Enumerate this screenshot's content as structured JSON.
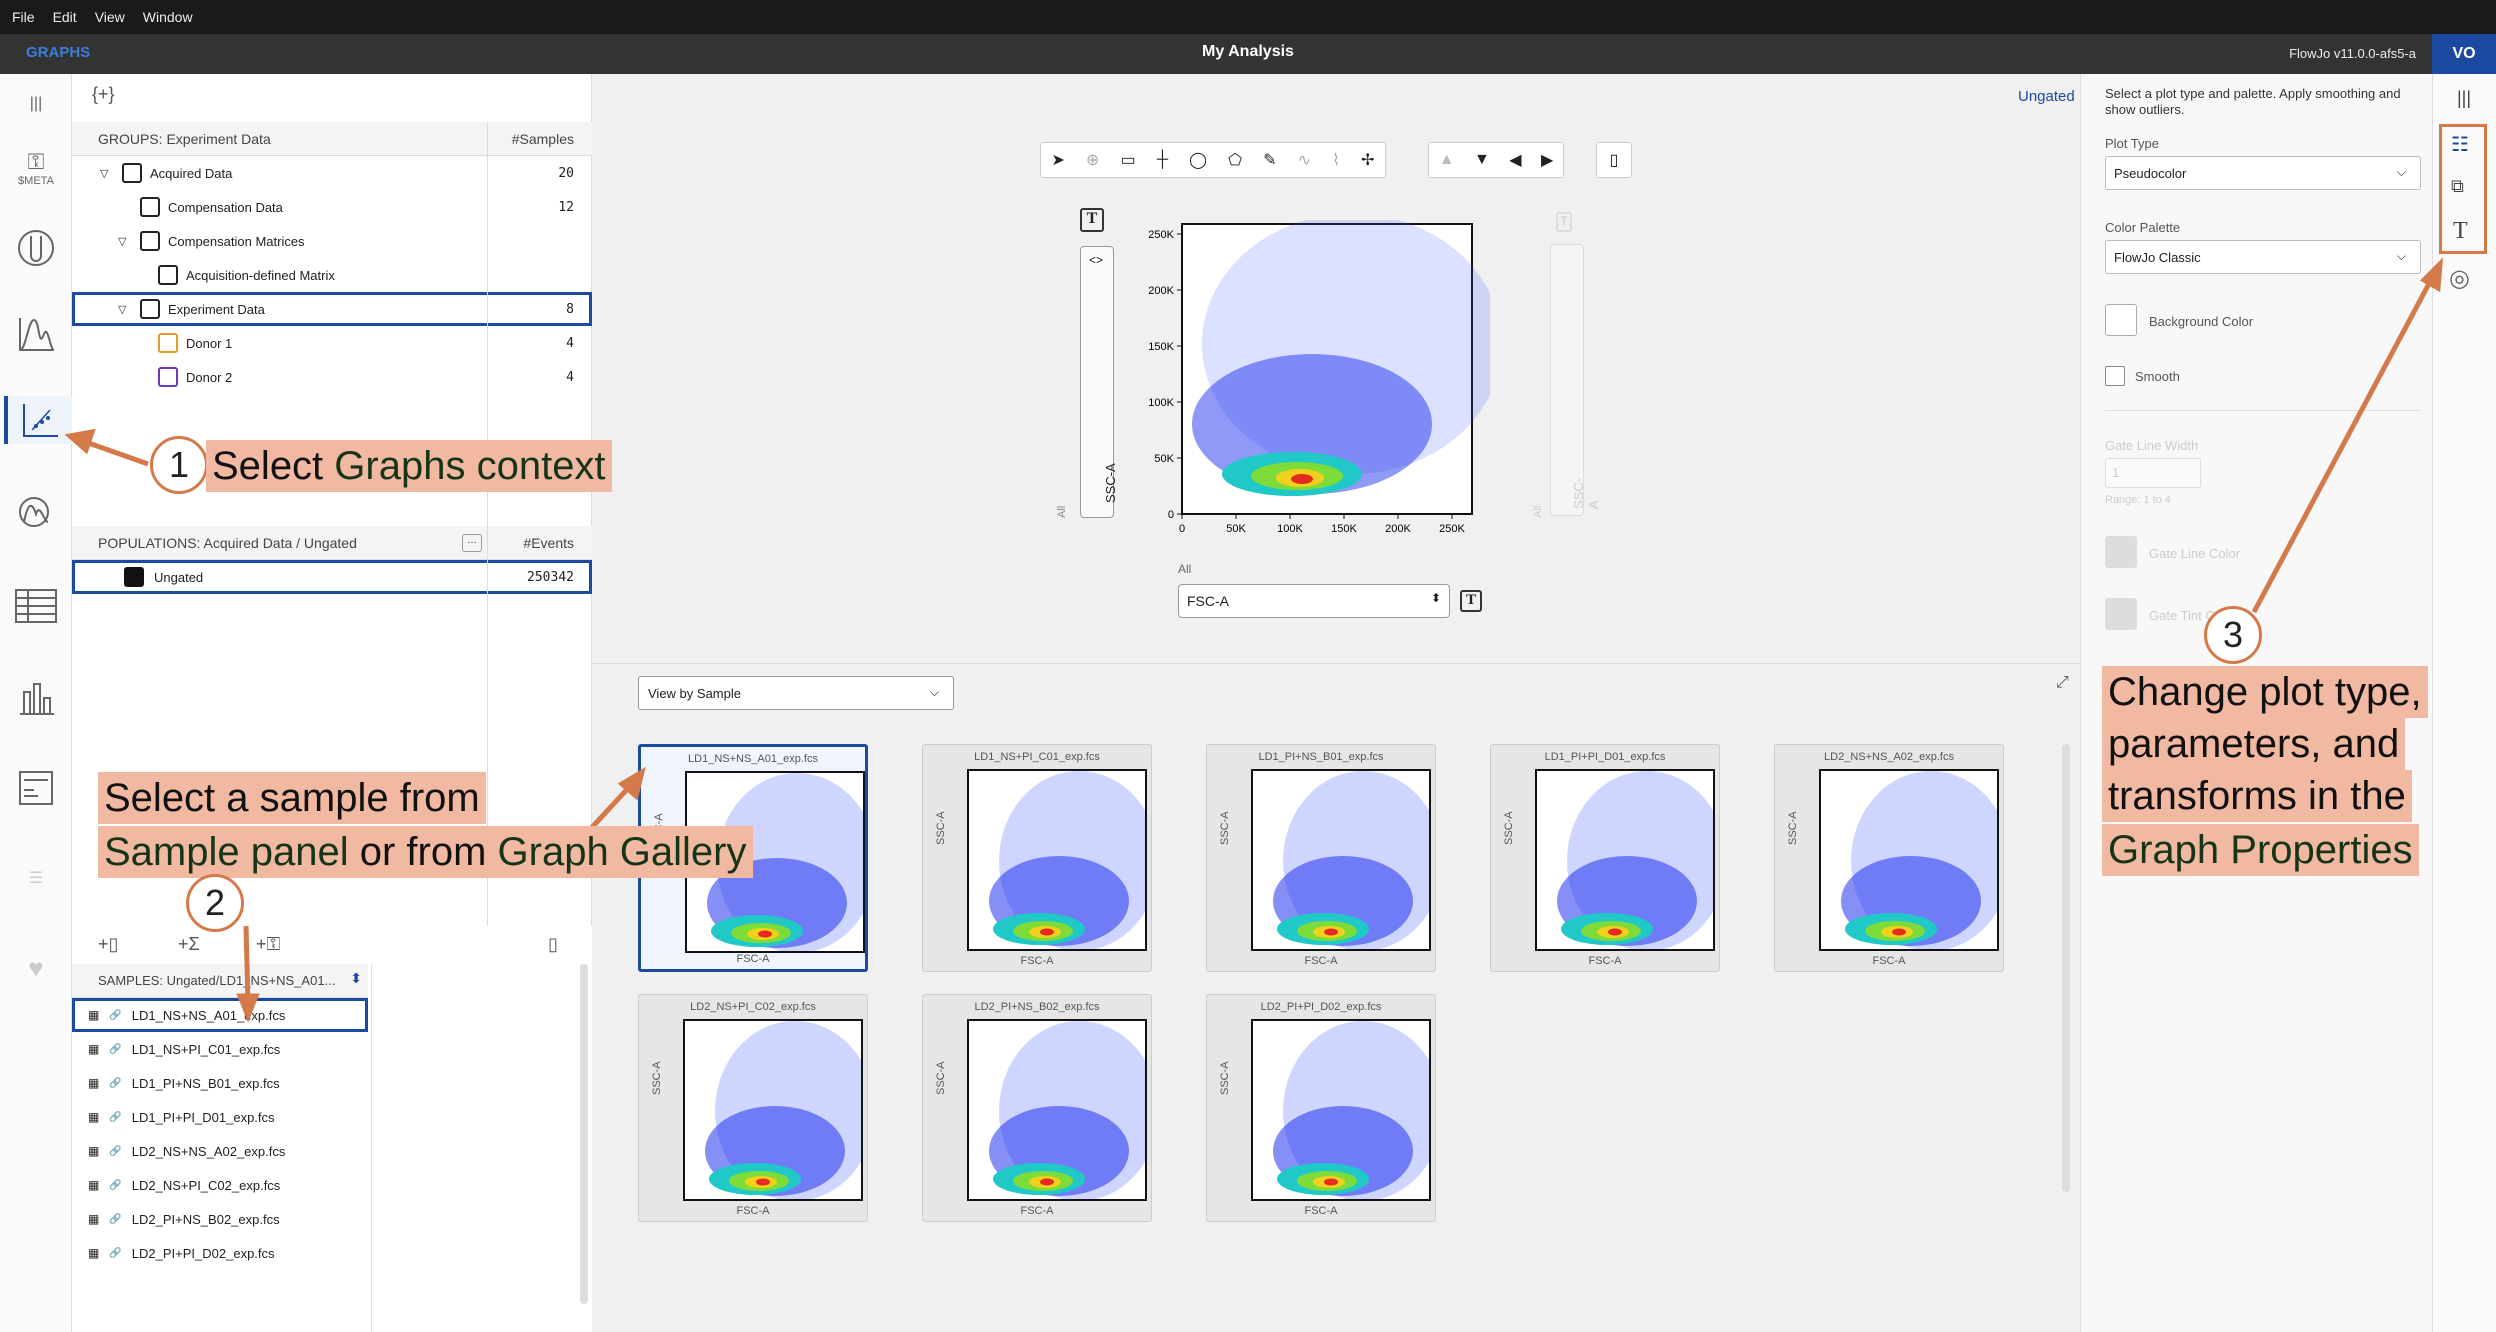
{
  "menu": [
    "File",
    "Edit",
    "View",
    "Window"
  ],
  "titlebar": {
    "context": "GRAPHS",
    "title": "My Analysis",
    "version": "FlowJo v11.0.0-afs5-a",
    "avatar": "VO"
  },
  "rail": {
    "meta_label": "$META"
  },
  "groups": {
    "header": "GROUPS: Experiment Data",
    "count_header": "#Samples",
    "rows": [
      {
        "label": "Acquired Data",
        "count": "20",
        "indent": 1,
        "twist": "▽"
      },
      {
        "label": "Compensation Data",
        "count": "12",
        "indent": 2,
        "twist": ""
      },
      {
        "label": "Compensation Matrices",
        "count": "",
        "indent": 2,
        "twist": "▽"
      },
      {
        "label": "Acquisition-defined Matrix",
        "count": "",
        "indent": 3,
        "twist": ""
      },
      {
        "label": "Experiment Data",
        "count": "8",
        "indent": 2,
        "twist": "▽"
      },
      {
        "label": "Donor 1",
        "count": "4",
        "indent": 3,
        "twist": ""
      },
      {
        "label": "Donor 2",
        "count": "4",
        "indent": 3,
        "twist": ""
      }
    ]
  },
  "populations": {
    "header": "POPULATIONS: Acquired Data / Ungated",
    "count_header": "#Events",
    "rows": [
      {
        "label": "Ungated",
        "count": "250342"
      }
    ]
  },
  "samples": {
    "header": "SAMPLES: Ungated/LD1_NS+NS_A01...",
    "rows": [
      "LD1_NS+NS_A01_exp.fcs",
      "LD1_NS+PI_C01_exp.fcs",
      "LD1_PI+NS_B01_exp.fcs",
      "LD1_PI+PI_D01_exp.fcs",
      "LD2_NS+NS_A02_exp.fcs",
      "LD2_NS+PI_C02_exp.fcs",
      "LD2_PI+NS_B02_exp.fcs",
      "LD2_PI+PI_D02_exp.fcs"
    ]
  },
  "main_plot": {
    "ungated_label": "Ungated",
    "y_param": "SSC-A",
    "y_gate_label": "All",
    "x_param": "FSC-A",
    "x_gate_label": "All",
    "y_ticks": [
      "250K",
      "200K",
      "150K",
      "100K",
      "50K",
      "0"
    ],
    "x_ticks": [
      "0",
      "50K",
      "100K",
      "150K",
      "200K",
      "250K"
    ],
    "text_btn": "T"
  },
  "gallery": {
    "view_select": "View by Sample",
    "x_label": "FSC-A",
    "y_label": "SSC-A",
    "thumbs": [
      "LD1_NS+NS_A01_exp.fcs",
      "LD1_NS+PI_C01_exp.fcs",
      "LD1_PI+NS_B01_exp.fcs",
      "LD1_PI+PI_D01_exp.fcs",
      "LD2_NS+NS_A02_exp.fcs",
      "LD2_NS+PI_C02_exp.fcs",
      "LD2_PI+NS_B02_exp.fcs",
      "LD2_PI+PI_D02_exp.fcs"
    ]
  },
  "properties": {
    "intro": "Select a plot type and palette. Apply smoothing and show outliers.",
    "plot_type_label": "Plot Type",
    "plot_type": "Pseudocolor",
    "palette_label": "Color Palette",
    "palette": "FlowJo Classic",
    "bg_color": "Background Color",
    "smooth": "Smooth",
    "gate_line_width": "Gate Line Width",
    "gate_line_value": "1",
    "range": "Range: 1 to 4",
    "gate_line_color": "Gate Line Color",
    "gate_tint": "Gate Tint C"
  },
  "annotations": {
    "a1_num": "1",
    "a1_pre": "Select ",
    "a1_bold": "Graphs context",
    "a2_num": "2",
    "a2_l1": "Select a sample from",
    "a2_b1": "Sample panel",
    "a2_mid": " or from ",
    "a2_b2": "Graph Gallery",
    "a3_num": "3",
    "a3_l1": "Change plot type,",
    "a3_l2": "parameters, and",
    "a3_l3": "transforms in the",
    "a3_b": "Graph Properties"
  }
}
